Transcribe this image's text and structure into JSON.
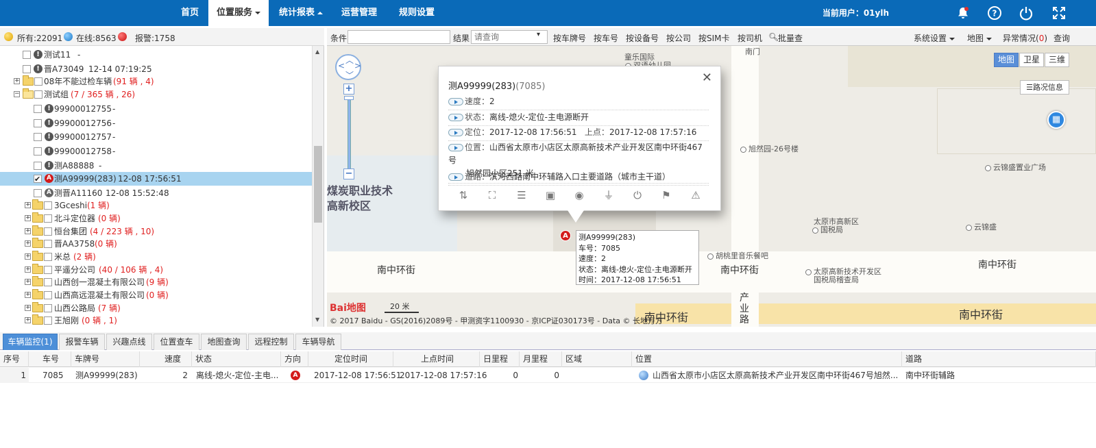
{
  "nav": {
    "items": [
      "首页",
      "位置服务",
      "统计报表",
      "运营管理",
      "规则设置"
    ],
    "user_label": "当前用户：01ylh"
  },
  "status": {
    "all": "所有:22091",
    "online": "在线:8563",
    "alarm": "报警:1758"
  },
  "tree": [
    {
      "label": "测试11",
      "extra": "-"
    },
    {
      "label": "晋A73049",
      "extra": "12-14 07:19:25"
    },
    {
      "label": "08年不能过检车辆",
      "count": "(91 辆 , 4)"
    },
    {
      "label": "测试组",
      "count": "(7 / 365 辆 , 26)"
    },
    {
      "label": "99900012755",
      "extra": "-"
    },
    {
      "label": "99900012756",
      "extra": "-"
    },
    {
      "label": "99900012757",
      "extra": "-"
    },
    {
      "label": "99900012758",
      "extra": "-"
    },
    {
      "label": "测A88888",
      "extra": "-"
    },
    {
      "label": "测A99999(283)",
      "extra": "12-08 17:56:51"
    },
    {
      "label": "测晋A11160",
      "extra": "12-08 15:52:48"
    },
    {
      "label": "3Gceshi",
      "count": "(1 辆)"
    },
    {
      "label": "北斗定位器",
      "count": "(0 辆)"
    },
    {
      "label": "恒台集团",
      "count": "(4 / 223 辆 , 10)"
    },
    {
      "label": "晋AA3758",
      "count": "(0 辆)"
    },
    {
      "label": "米总",
      "count": "(2 辆)"
    },
    {
      "label": "平遥分公司",
      "count": "(40 / 106 辆 , 4)"
    },
    {
      "label": "山西创一混凝土有限公司",
      "count": "(9 辆)"
    },
    {
      "label": "山西高远混凝土有限公司",
      "count": "(0 辆)"
    },
    {
      "label": "山西公路局",
      "count": "(7 辆)"
    },
    {
      "label": "王旭刚",
      "count": "(0 辆 , 1)"
    }
  ],
  "toolbar": {
    "cond_label": "条件",
    "result_label": "结果",
    "result_placeholder": "请查询",
    "buttons": [
      "按车牌号",
      "按车号",
      "按设备号",
      "按公司",
      "按SIM卡",
      "按司机",
      "批量查"
    ],
    "sys_settings": "系统设置",
    "map_menu": "地图",
    "exception": "异常情况(",
    "exception_count": "0",
    "exception_close": ")",
    "query": "查询"
  },
  "map": {
    "types": [
      "地图",
      "卫星",
      "三维"
    ],
    "traffic": "路况信息",
    "labels": {
      "kindergarten1": "童乐国际",
      "kindergarten2": "双语幼儿园",
      "south_gate": "南门",
      "xuran": "旭然园-26号楼",
      "yunjin_plaza": "云锦盛置业广场",
      "coal1": "煤炭职业技术",
      "coal2": "高新校区",
      "tax1": "太原市高新区",
      "tax2": "国税局",
      "yunjin": "云锦盛",
      "walnut": "胡桃里音乐餐吧",
      "tax_dev1": "太原高新技术开发区",
      "tax_dev2": "国税局稽查局",
      "road1": "南中环街",
      "road2": "南中环街",
      "road3": "南中环街",
      "road4": "南中环街",
      "road5": "南中环街",
      "chanye": "产业路",
      "scale": "20 米",
      "baidu_logo": "Bai地图"
    },
    "copyright": "© 2017 Baidu - GS(2016)2089号 - 甲测资字1100930 - 京ICP证030173号 - Data © 长地万方"
  },
  "popup": {
    "title": "测A99999(283)",
    "title_id": "(7085)",
    "rows": [
      {
        "label": "速度：",
        "value": "2"
      },
      {
        "label": "状态：",
        "value": "离线-熄火-定位-主电源断开"
      },
      {
        "label": "定位：",
        "value": "2017-12-08 17:56:51",
        "label2": "上点：",
        "value2": "2017-12-08 17:57:16"
      },
      {
        "label": "位置：",
        "value": "山西省太原市小店区太原高新技术产业开发区南中环街467号",
        "value_cont": "旭然园小区251 米"
      },
      {
        "label": "道路：",
        "value": "滨河西路南中环辅路入口主要道路（城市主干道）"
      }
    ]
  },
  "tooltip": {
    "lines": [
      "测A99999(283)",
      "车号：7085",
      "速度：2",
      "状态：离线-熄火-定位-主电源断开",
      "时间：2017-12-08 17:56:51"
    ]
  },
  "tabs": [
    "车辆监控(1)",
    "报警车辆",
    "兴趣点线",
    "位置查车",
    "地图查询",
    "远程控制",
    "车辆导航"
  ],
  "table": {
    "headers": [
      "序号",
      "车号",
      "车牌号",
      "速度",
      "状态",
      "方向",
      "定位时间",
      "上点时间",
      "日里程",
      "月里程",
      "区域",
      "位置",
      "道路"
    ],
    "rows": [
      [
        "1",
        "7085",
        "测A99999(283)",
        "2",
        "离线-熄火-定位-主电...",
        "",
        "2017-12-08 17:56:51",
        "2017-12-08 17:57:16",
        "0",
        "0",
        "",
        "山西省太原市小店区太原高新技术产业开发区南中环街467号旭然...",
        "南中环街辅路"
      ]
    ]
  },
  "colors": {
    "nav_bg": "#0a6ab8",
    "accent": "#4d8fd8",
    "alarm_red": "#d31b1b",
    "selected_row": "#a8d4f0"
  }
}
